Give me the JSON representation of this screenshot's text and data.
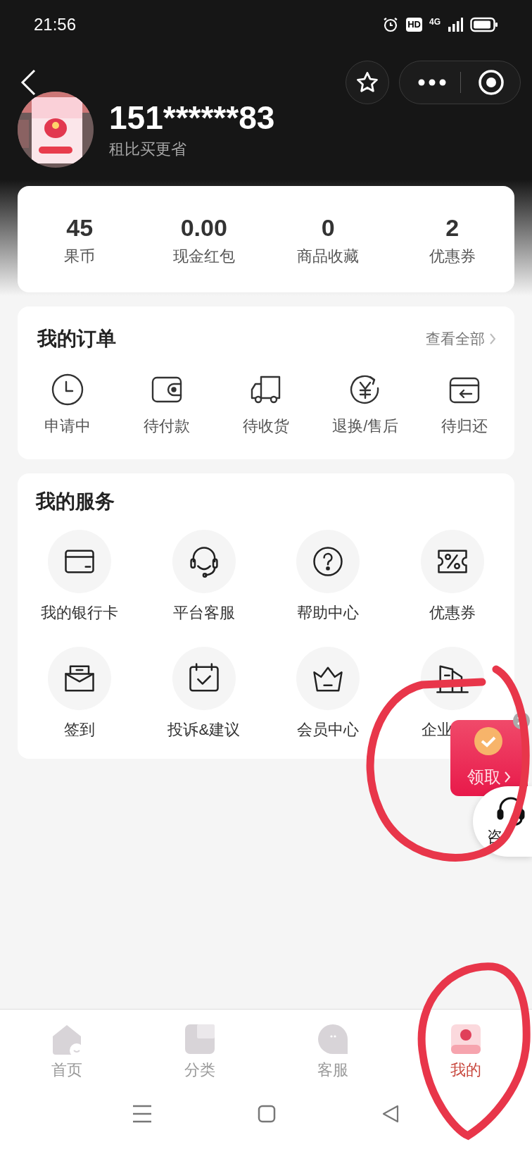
{
  "status_bar": {
    "time": "21:56",
    "hd_badge": "HD",
    "network": "4G"
  },
  "profile": {
    "phone": "151******83",
    "slogan": "租比买更省"
  },
  "stats": [
    {
      "value": "45",
      "label": "果币"
    },
    {
      "value": "0.00",
      "label": "现金红包"
    },
    {
      "value": "0",
      "label": "商品收藏"
    },
    {
      "value": "2",
      "label": "优惠券"
    }
  ],
  "orders": {
    "title": "我的订单",
    "view_all": "查看全部",
    "items": [
      "申请中",
      "待付款",
      "待收货",
      "退换/售后",
      "待归还"
    ]
  },
  "services": {
    "title": "我的服务",
    "items": [
      "我的银行卡",
      "平台客服",
      "帮助中心",
      "优惠券",
      "签到",
      "投诉&建议",
      "会员中心",
      "企业"
    ]
  },
  "floating": {
    "envelope_label": "领取",
    "consult_label": "咨"
  },
  "tab_bar": [
    {
      "label": "首页",
      "selected": false
    },
    {
      "label": "分类",
      "selected": false
    },
    {
      "label": "客服",
      "selected": false
    },
    {
      "label": "我的",
      "selected": true
    }
  ]
}
